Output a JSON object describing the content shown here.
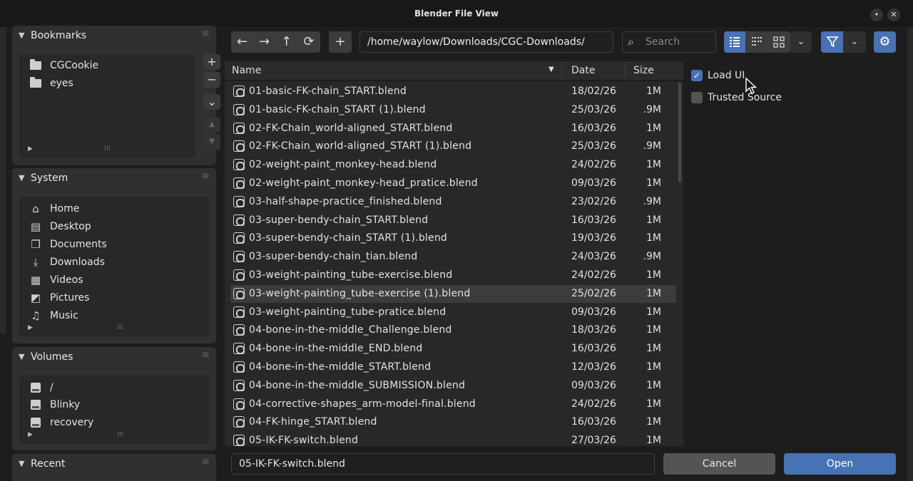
{
  "window": {
    "title": "Blender File View",
    "pin_symbol": "•",
    "close_symbol": "✕"
  },
  "bookmarks": {
    "title": "Bookmarks",
    "items": [
      {
        "label": "CGCookie",
        "icon": "folder-icon"
      },
      {
        "label": "eyes",
        "icon": "folder-icon"
      }
    ],
    "add": "+",
    "remove": "−",
    "menu": "⌄",
    "up": "▲",
    "down": "▼"
  },
  "system": {
    "title": "System",
    "items": [
      {
        "label": "Home",
        "glyph": "⌂"
      },
      {
        "label": "Desktop",
        "glyph": "▤"
      },
      {
        "label": "Documents",
        "glyph": "❐"
      },
      {
        "label": "Downloads",
        "glyph": "⤓"
      },
      {
        "label": "Videos",
        "glyph": "▦"
      },
      {
        "label": "Pictures",
        "glyph": "◩"
      },
      {
        "label": "Music",
        "glyph": "♫"
      }
    ]
  },
  "volumes": {
    "title": "Volumes",
    "items": [
      {
        "label": "/"
      },
      {
        "label": "Blinky"
      },
      {
        "label": "recovery"
      }
    ]
  },
  "recent": {
    "title": "Recent"
  },
  "toolbar": {
    "back": "←",
    "forward": "→",
    "parent": "↑",
    "refresh": "⟳",
    "new_folder": "+",
    "path": "/home/waylow/Downloads/CGC-Downloads/",
    "search_placeholder": "Search"
  },
  "columns": {
    "name": "Name",
    "date": "Date",
    "size": "Size",
    "sort_indicator": "▼"
  },
  "files": [
    {
      "name": "01-basic-FK-chain_START.blend",
      "date": "18/02/26",
      "size": "1M"
    },
    {
      "name": "01-basic-FK-chain_START (1).blend",
      "date": "25/03/26",
      "size": ".9M"
    },
    {
      "name": "02-FK-Chain_world-aligned_START.blend",
      "date": "16/03/26",
      "size": "1M"
    },
    {
      "name": "02-FK-Chain_world-aligned_START (1).blend",
      "date": "25/03/26",
      "size": ".9M"
    },
    {
      "name": "02-weight-paint_monkey-head.blend",
      "date": "24/02/26",
      "size": "1M"
    },
    {
      "name": "02-weight-paint_monkey-head_pratice.blend",
      "date": "09/03/26",
      "size": "1M"
    },
    {
      "name": "03-half-shape-practice_finished.blend",
      "date": "23/02/26",
      "size": ".9M"
    },
    {
      "name": "03-super-bendy-chain_START.blend",
      "date": "16/03/26",
      "size": "1M"
    },
    {
      "name": "03-super-bendy-chain_START (1).blend",
      "date": "19/03/26",
      "size": "1M"
    },
    {
      "name": "03-super-bendy-chain_tian.blend",
      "date": "24/03/26",
      "size": ".9M"
    },
    {
      "name": "03-weight-painting_tube-exercise.blend",
      "date": "24/02/26",
      "size": "1M"
    },
    {
      "name": "03-weight-painting_tube-exercise (1).blend",
      "date": "25/02/26",
      "size": "1M",
      "selected": true
    },
    {
      "name": "03-weight-painting_tube-pratice.blend",
      "date": "09/03/26",
      "size": "1M"
    },
    {
      "name": "04-bone-in-the-middle_Challenge.blend",
      "date": "18/03/26",
      "size": "1M"
    },
    {
      "name": "04-bone-in-the-middle_END.blend",
      "date": "16/03/26",
      "size": "1M"
    },
    {
      "name": "04-bone-in-the-middle_START.blend",
      "date": "12/03/26",
      "size": "1M"
    },
    {
      "name": "04-bone-in-the-middle_SUBMISSION.blend",
      "date": "09/03/26",
      "size": "1M"
    },
    {
      "name": "04-corrective-shapes_arm-model-final.blend",
      "date": "24/02/26",
      "size": "1M"
    },
    {
      "name": "04-FK-hinge_START.blend",
      "date": "16/03/26",
      "size": "1M"
    },
    {
      "name": "05-IK-FK-switch.blend",
      "date": "27/03/26",
      "size": "1M"
    }
  ],
  "options": {
    "load_ui": {
      "label": "Load UI",
      "checked": true
    },
    "trusted_source": {
      "label": "Trusted Source",
      "checked": false
    }
  },
  "footer": {
    "filename": "05-IK-FK-switch.blend",
    "cancel": "Cancel",
    "open": "Open"
  },
  "colors": {
    "accent": "#4772b3",
    "panel": "#303030",
    "background": "#1d1d1d"
  }
}
